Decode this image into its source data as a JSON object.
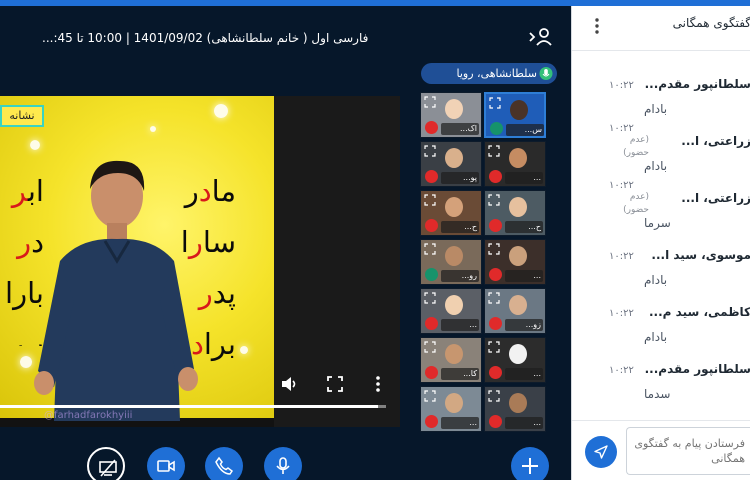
{
  "meeting": {
    "title": "فارسی اول ( خانم سلطانشاهی) 1401/09/02 | 10:00 تا 45:...",
    "current_talker": "سلطانشاهی، رویا"
  },
  "presentation": {
    "label": "نشانه",
    "column1": [
      {
        "before": "ما",
        "hl": "د",
        "after": "ر"
      },
      {
        "before": "سا",
        "hl": "ر",
        "after": "ا"
      },
      {
        "before": "پد",
        "hl": "ر",
        "after": ""
      },
      {
        "before": "برا",
        "hl": "د",
        "after": "ر"
      }
    ],
    "column2": [
      {
        "before": "اب",
        "hl": "ر",
        "after": ""
      },
      {
        "before": "د",
        "hl": "ر",
        "after": ""
      },
      {
        "before": "بارا",
        "hl": "",
        "after": ""
      },
      {
        "before": "ب",
        "hl": "",
        "after": ""
      }
    ],
    "watermark": "@farhadfarokhyiii",
    "progress": 0.98
  },
  "participants": [
    {
      "name": "اک...",
      "muted": true,
      "active": false
    },
    {
      "name": "س...",
      "muted": false,
      "active": true
    },
    {
      "name": "پو...",
      "muted": true,
      "active": false
    },
    {
      "name": "...",
      "muted": true,
      "active": false
    },
    {
      "name": "ح...",
      "muted": true,
      "active": false
    },
    {
      "name": "ح...",
      "muted": true,
      "active": false
    },
    {
      "name": "رو...",
      "muted": false,
      "active": false
    },
    {
      "name": "...",
      "muted": true,
      "active": false
    },
    {
      "name": "...",
      "muted": true,
      "active": false
    },
    {
      "name": "زو...",
      "muted": true,
      "active": false
    },
    {
      "name": "کا...",
      "muted": true,
      "active": false
    },
    {
      "name": "...",
      "muted": true,
      "active": false
    },
    {
      "name": "...",
      "muted": true,
      "active": false
    },
    {
      "name": "...",
      "muted": true,
      "active": false
    }
  ],
  "chat": {
    "title": "گفتگوی همگانی",
    "input_placeholder": "فرستادن پیام به گفتگوی همگانی",
    "messages": [
      {
        "name": "سلطانپور مقدم...",
        "time": "۱۰:۲۲",
        "status": "",
        "text": "بادام"
      },
      {
        "name": "زراعتی، ا...",
        "time": "۱۰:۲۲",
        "status": "(عدم حضور)",
        "text": "بادام"
      },
      {
        "name": "زراعتی، ا...",
        "time": "۱۰:۲۲",
        "status": "(عدم حضور)",
        "text": "سرما"
      },
      {
        "name": "موسوی، سید ا...",
        "time": "۱۰:۲۲",
        "status": "",
        "text": "بادام"
      },
      {
        "name": "کاظمی، سید م...",
        "time": "۱۰:۲۲",
        "status": "",
        "text": "بادام"
      },
      {
        "name": "سلطانپور مقدم...",
        "time": "۱۰:۲۲",
        "status": "",
        "text": "سدما"
      }
    ]
  },
  "colors": {
    "accent": "#1f6fd6",
    "background": "#06172a",
    "slide": "#f5e32a",
    "highlight": "#d81a1a"
  },
  "icons": {
    "user_toggle": "user-list-icon",
    "talker": "microphone-icon",
    "screenshare": "screenshare-off-icon",
    "camera": "camera-icon",
    "phone": "phone-icon",
    "microphone": "microphone-icon",
    "add": "plus-icon",
    "send": "send-icon"
  }
}
